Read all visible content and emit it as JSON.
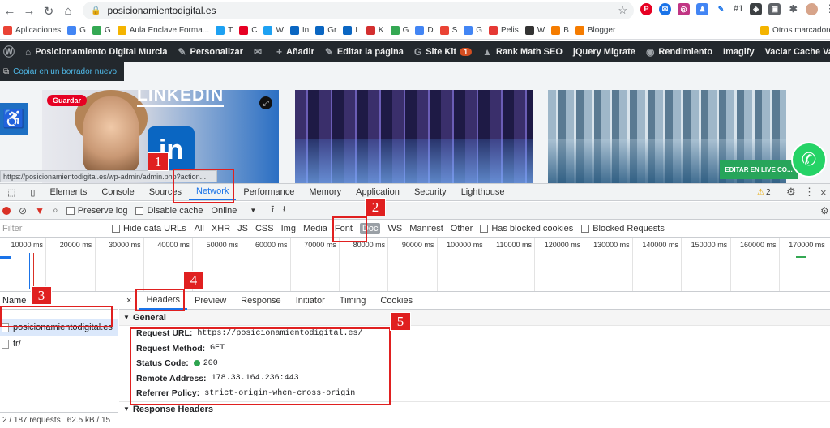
{
  "browser": {
    "url": "posicionamientodigital.es",
    "extension_badge": "#1"
  },
  "bookmarks": [
    {
      "label": "Aplicaciones",
      "color": "#ea4335"
    },
    {
      "label": "G",
      "color": "#4285f4"
    },
    {
      "label": "G",
      "color": "#34a853"
    },
    {
      "label": "Aula Enclave Forma...",
      "color": "#f4b400"
    },
    {
      "label": "T",
      "color": "#1da1f2"
    },
    {
      "label": "C",
      "color": "#e60023"
    },
    {
      "label": "W",
      "color": "#1da1f2"
    },
    {
      "label": "In",
      "color": "#0a66c2"
    },
    {
      "label": "Gr",
      "color": "#0a66c2"
    },
    {
      "label": "L",
      "color": "#0a66c2"
    },
    {
      "label": "K",
      "color": "#d32f2f"
    },
    {
      "label": "G",
      "color": "#34a853"
    },
    {
      "label": "D",
      "color": "#4285f4"
    },
    {
      "label": "S",
      "color": "#ea4335"
    },
    {
      "label": "G",
      "color": "#4285f4"
    },
    {
      "label": "Pelis",
      "color": "#e53935"
    },
    {
      "label": "W",
      "color": "#333333"
    },
    {
      "label": "B",
      "color": "#f57c00"
    },
    {
      "label": "Blogger",
      "color": "#f57c00"
    },
    {
      "label": "Otros marcadores",
      "color": "#f4b400"
    }
  ],
  "adminbar": {
    "items": [
      {
        "label": "Posicionamiento Digital Murcia",
        "icon": "⌂"
      },
      {
        "label": "Personalizar",
        "icon": "✎"
      },
      {
        "label": "",
        "icon": "✉"
      },
      {
        "label": "Añadir",
        "icon": "+"
      },
      {
        "label": "Editar la página",
        "icon": "✎"
      },
      {
        "label": "Site Kit",
        "icon": "G",
        "badge": "1"
      },
      {
        "label": "Rank Math SEO",
        "icon": "▲"
      },
      {
        "label": "jQuery Migrate",
        "icon": ""
      },
      {
        "label": "Rendimiento",
        "icon": "◉"
      },
      {
        "label": "Imagify",
        "icon": ""
      },
      {
        "label": "Vaciar Cache Varnish",
        "icon": ""
      }
    ]
  },
  "webpage": {
    "copy_label": "Copiar en un borrador nuevo",
    "pin_label": "Guardar",
    "card_title": "LINKEDIN",
    "linkedin_logo": "in",
    "live_label": "EDITAR EN LIVE CO...",
    "status_url": "https://posicionamientodigital.es/wp-admin/admin.php?action..."
  },
  "devtools": {
    "tabs": [
      "Elements",
      "Console",
      "Sources",
      "Network",
      "Performance",
      "Memory",
      "Application",
      "Security",
      "Lighthouse"
    ],
    "active_tab": "Network",
    "warnings": "2",
    "toolbar": {
      "preserve_log": "Preserve log",
      "disable_cache": "Disable cache",
      "throttle": "Online"
    },
    "filter": {
      "placeholder": "Filter",
      "hide_data_urls": "Hide data URLs",
      "types": [
        "All",
        "XHR",
        "JS",
        "CSS",
        "Img",
        "Media",
        "Font",
        "Doc",
        "WS",
        "Manifest",
        "Other"
      ],
      "selected_type": "Doc",
      "has_blocked_cookies": "Has blocked cookies",
      "blocked_requests": "Blocked Requests"
    },
    "timeline_ticks": [
      "10000 ms",
      "20000 ms",
      "30000 ms",
      "40000 ms",
      "50000 ms",
      "60000 ms",
      "70000 ms",
      "80000 ms",
      "90000 ms",
      "100000 ms",
      "110000 ms",
      "120000 ms",
      "130000 ms",
      "140000 ms",
      "150000 ms",
      "160000 ms",
      "170000 ms"
    ],
    "requests_header": "Name",
    "requests": [
      "posicionamientodigital.es",
      "tr/"
    ],
    "summary": {
      "requests": "2 / 187 requests",
      "transferred": "62.5 kB / 15"
    },
    "detail_tabs": [
      "Headers",
      "Preview",
      "Response",
      "Initiator",
      "Timing",
      "Cookies"
    ],
    "active_detail_tab": "Headers",
    "general_title": "General",
    "general": [
      {
        "key": "Request URL:",
        "value": "https://posicionamientodigital.es/"
      },
      {
        "key": "Request Method:",
        "value": "GET"
      },
      {
        "key": "Status Code:",
        "value": "200"
      },
      {
        "key": "Remote Address:",
        "value": "178.33.164.236:443"
      },
      {
        "key": "Referrer Policy:",
        "value": "strict-origin-when-cross-origin"
      }
    ],
    "response_headers_title": "Response Headers"
  },
  "annotations": [
    "1",
    "2",
    "3",
    "4",
    "5"
  ]
}
